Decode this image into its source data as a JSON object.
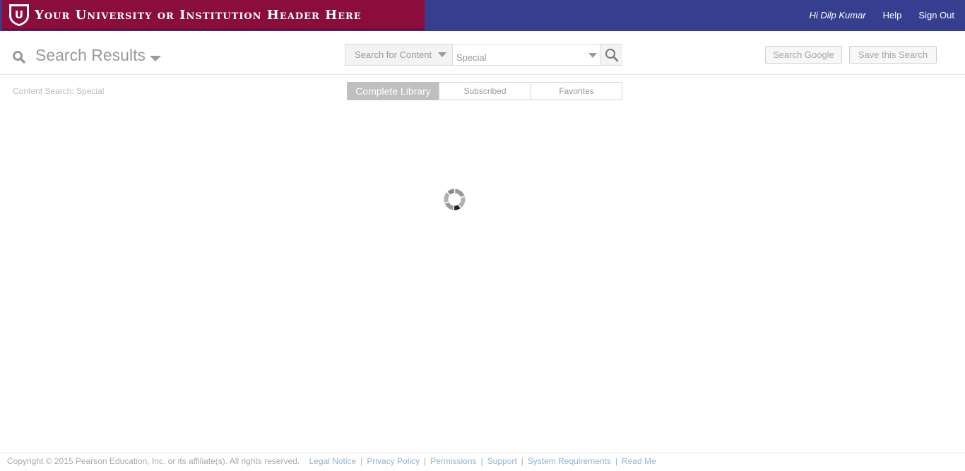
{
  "header": {
    "banner_text": "Your University or Institution Header Here",
    "shield_letter": "U",
    "greeting": "Hi Dilp Kumar",
    "help_label": "Help",
    "signout_label": "Sign Out",
    "colors": {
      "nav_bg": "#363f8f",
      "banner_bg": "#8b0d3c"
    }
  },
  "search": {
    "title": "Search Results",
    "type_label": "Search for Content",
    "query": "Special",
    "google_button": "Search Google",
    "save_button": "Save this Search"
  },
  "content": {
    "label": "Content Search: Special",
    "tabs": [
      {
        "label": "Complete Library",
        "active": true
      },
      {
        "label": "Subscribed",
        "active": false
      },
      {
        "label": "Favorites",
        "active": false
      }
    ]
  },
  "footer": {
    "copyright": "Copyright © 2015 Pearson Education, Inc. or its affiliate(s). All rights reserved.",
    "links": [
      "Legal Notice",
      "Privacy Policy",
      "Permissions",
      "Support",
      "System Requirements",
      "Read Me"
    ],
    "link_color": "#8fb5d6"
  },
  "icons": {
    "search": "search-icon",
    "caret": "caret-down-icon",
    "spinner": "loading-spinner-icon",
    "shield": "shield-logo-icon"
  }
}
